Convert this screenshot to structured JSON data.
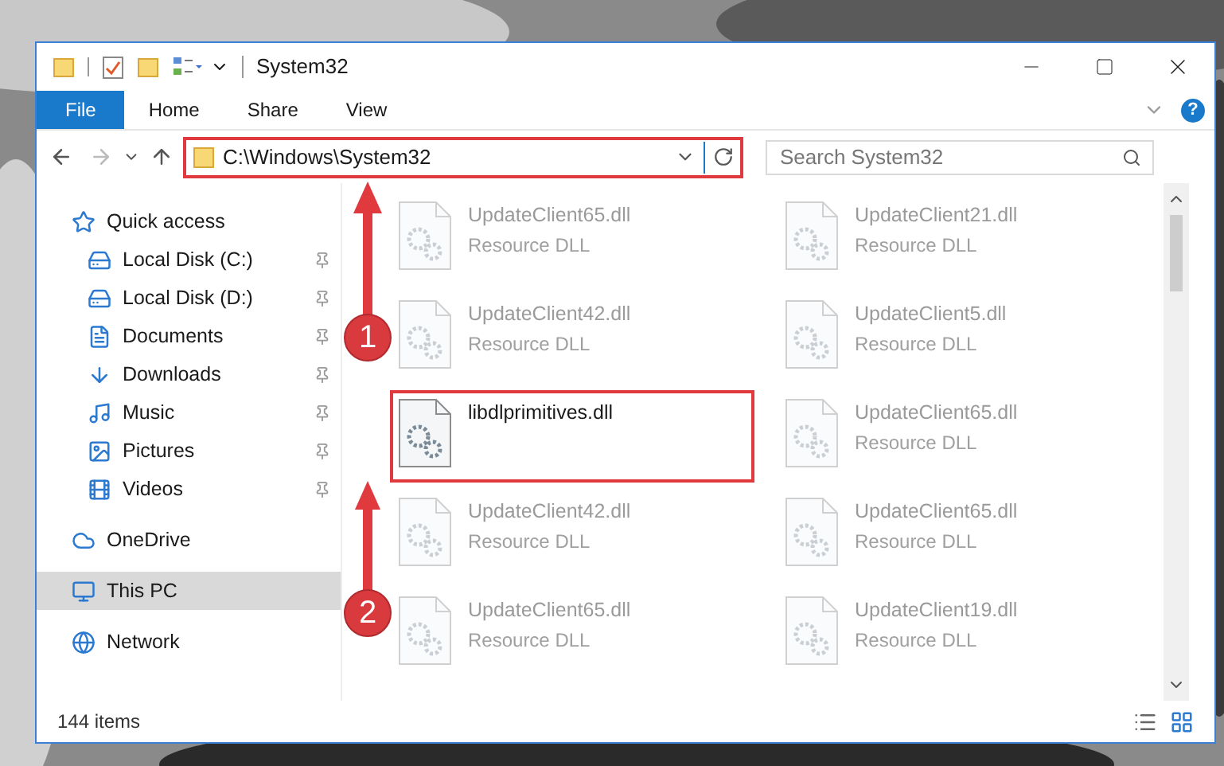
{
  "window": {
    "title": "System32"
  },
  "ribbon_tabs": [
    {
      "label": "File",
      "selected": true
    },
    {
      "label": "Home",
      "selected": false
    },
    {
      "label": "Share",
      "selected": false
    },
    {
      "label": "View",
      "selected": false
    }
  ],
  "address": {
    "path": "C:\\Windows\\System32",
    "highlighted": true
  },
  "search": {
    "placeholder": "Search System32"
  },
  "help": "?",
  "sidebar": {
    "items": [
      {
        "label": "Quick access",
        "selected": false,
        "children": [
          {
            "label": "Local Disk (C:)",
            "pinned": true,
            "selected": false
          },
          {
            "label": "Local Disk (D:)",
            "pinned": true,
            "selected": false
          },
          {
            "label": "Documents",
            "pinned": true,
            "selected": false
          },
          {
            "label": "Downloads",
            "pinned": true,
            "selected": false
          },
          {
            "label": "Music",
            "pinned": true,
            "selected": false
          },
          {
            "label": "Pictures",
            "pinned": true,
            "selected": false
          },
          {
            "label": "Videos",
            "pinned": true,
            "selected": false
          }
        ]
      },
      {
        "label": "OneDrive",
        "selected": false
      },
      {
        "label": "This PC",
        "selected": true
      },
      {
        "label": "Network",
        "selected": false
      }
    ]
  },
  "files": [
    {
      "name": "UpdateClient65.dll",
      "type": "Resource DLL",
      "highlighted": false
    },
    {
      "name": "UpdateClient21.dll",
      "type": "Resource DLL",
      "highlighted": false
    },
    {
      "name": "UpdateClient42.dll",
      "type": "Resource DLL",
      "highlighted": false
    },
    {
      "name": "UpdateClient5.dll",
      "type": "Resource DLL",
      "highlighted": false
    },
    {
      "name": "libdlprimitives.dll",
      "highlighted": true
    },
    {
      "name": "UpdateClient65.dll",
      "type": "Resource DLL",
      "highlighted": false
    },
    {
      "name": "UpdateClient42.dll",
      "type": "Resource DLL",
      "highlighted": false
    },
    {
      "name": "UpdateClient65.dll",
      "type": "Resource DLL",
      "highlighted": false
    },
    {
      "name": "UpdateClient65.dll",
      "type": "Resource DLL",
      "highlighted": false
    },
    {
      "name": "UpdateClient19.dll",
      "type": "Resource DLL",
      "highlighted": false
    }
  ],
  "status_bar": {
    "items": "144 items"
  },
  "annotations": [
    {
      "number": "1"
    },
    {
      "number": "2"
    }
  ]
}
